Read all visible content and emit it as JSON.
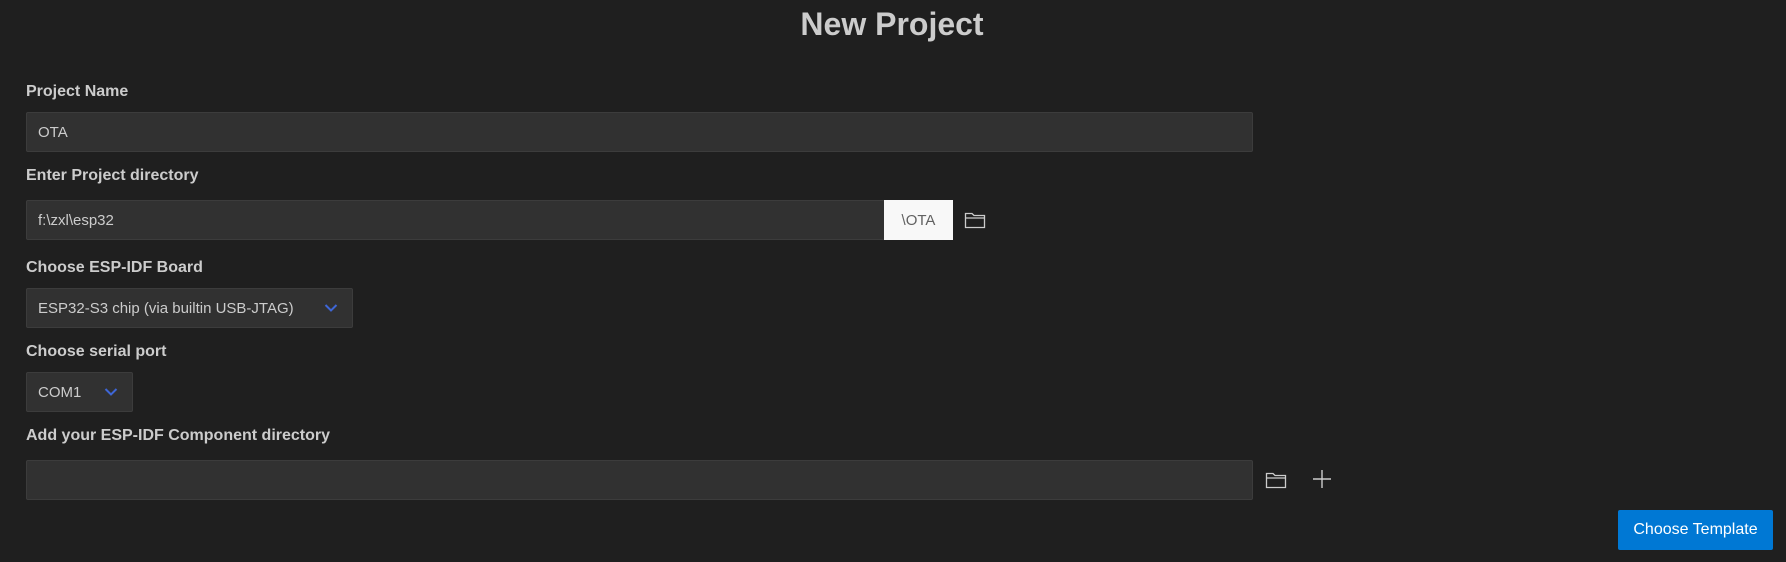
{
  "page": {
    "title": "New Project"
  },
  "project_name": {
    "label": "Project Name",
    "value": "OTA"
  },
  "project_directory": {
    "label": "Enter Project directory",
    "value": "f:\\zxl\\esp32",
    "suffix": "\\OTA",
    "browse_icon": "folder-icon"
  },
  "board": {
    "label": "Choose ESP-IDF Board",
    "selected": "ESP32-S3 chip (via builtin USB-JTAG)",
    "icon": "chevron-down-icon"
  },
  "serial_port": {
    "label": "Choose serial port",
    "selected": "COM1",
    "icon": "chevron-down-icon"
  },
  "component_directory": {
    "label": "Add your ESP-IDF Component directory",
    "value": "",
    "browse_icon": "folder-icon",
    "add_icon": "plus-icon"
  },
  "actions": {
    "choose_template_label": "Choose Template"
  },
  "colors": {
    "background": "#1f1f1f",
    "input_background": "#313131",
    "accent": "#0078d4",
    "chevron": "#3e66d6"
  }
}
